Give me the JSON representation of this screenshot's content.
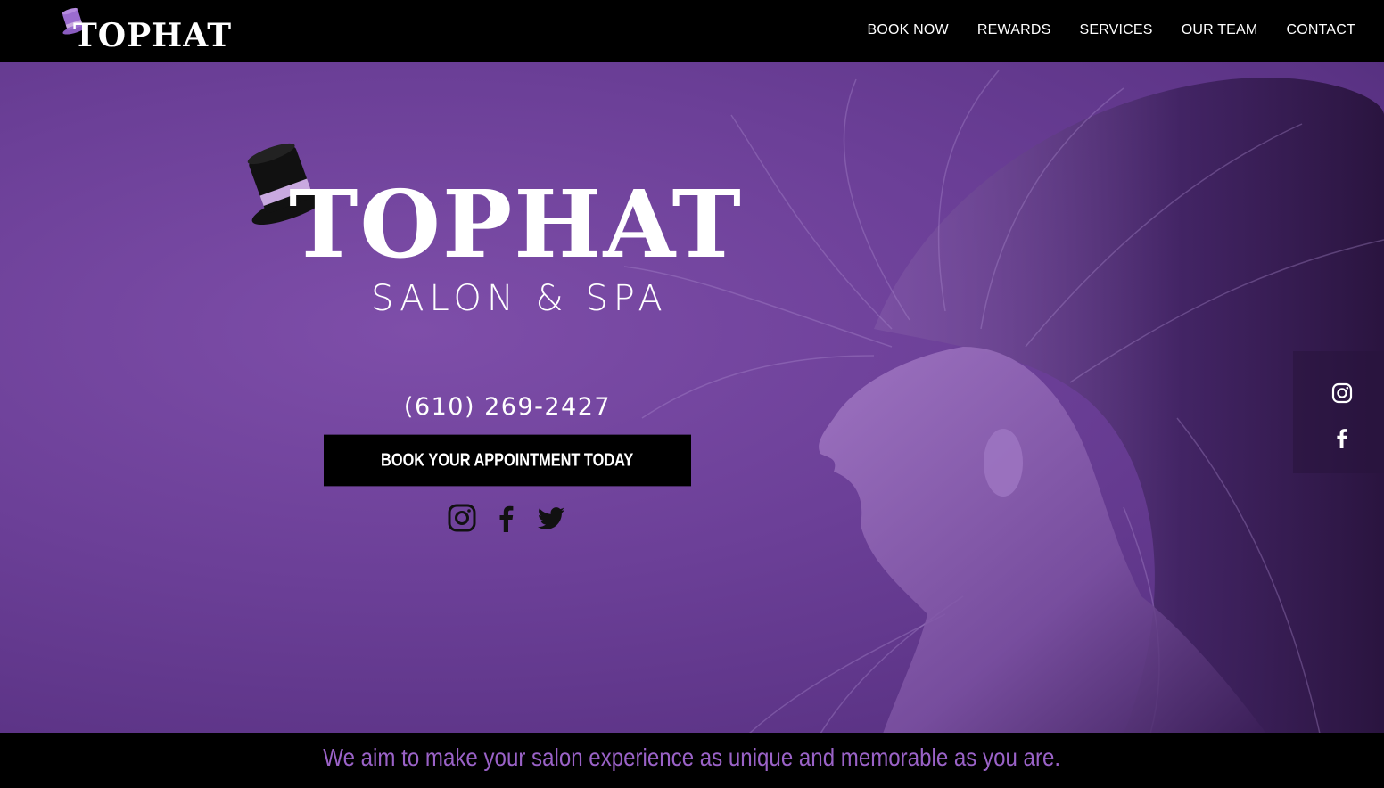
{
  "header": {
    "logo_text": "TOPHAT",
    "nav": [
      {
        "label": "BOOK NOW"
      },
      {
        "label": "REWARDS"
      },
      {
        "label": "SERVICES"
      },
      {
        "label": "OUR TEAM"
      },
      {
        "label": "CONTACT"
      }
    ]
  },
  "hero": {
    "brand": "TOPHAT",
    "subtitle": "SALON & SPA",
    "phone": "(610) 269-2427",
    "cta_label": "BOOK YOUR APPOINTMENT TODAY",
    "social_icons": [
      "instagram-icon",
      "facebook-icon",
      "twitter-icon"
    ]
  },
  "side_social": {
    "icons": [
      "instagram-icon",
      "facebook-icon"
    ]
  },
  "footer_band": {
    "tagline": "We aim to make your salon experience as unique and memorable as you are."
  },
  "colors": {
    "nav_bg": "#000000",
    "hero_purple": "#6b3f97",
    "tagline_purple": "#9a62c7",
    "hat_band": "#c9a9e0"
  }
}
